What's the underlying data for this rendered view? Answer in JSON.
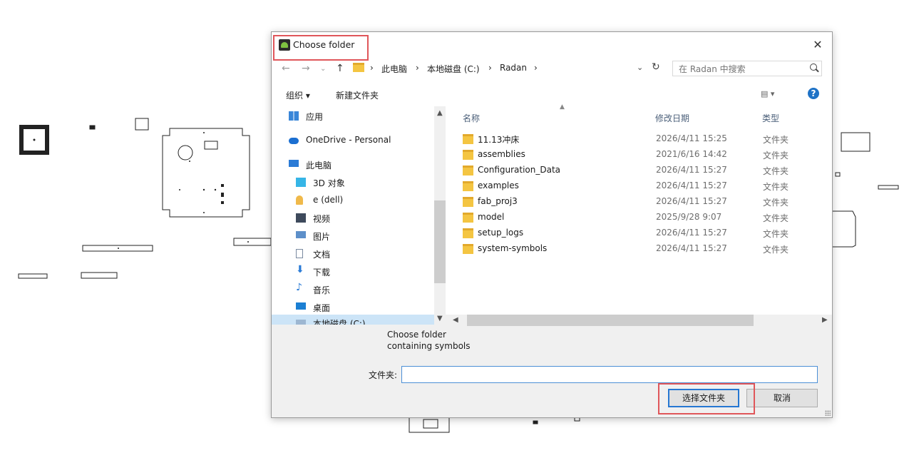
{
  "dialog": {
    "title": "Choose folder",
    "close_icon": "close-icon",
    "address": {
      "crumbs": [
        "此电脑",
        "本地磁盘 (C:)",
        "Radan"
      ],
      "separator": "›"
    },
    "search": {
      "placeholder": "在 Radan 中搜索"
    },
    "commands": {
      "organize": "组织 ▾",
      "new_folder": "新建文件夹"
    },
    "nav_pane": {
      "items": [
        {
          "label": "应用",
          "icon": "apps-icon"
        },
        {
          "label": "OneDrive - Personal",
          "icon": "cloud-icon"
        },
        {
          "label": "此电脑",
          "icon": "computer-icon"
        },
        {
          "label": "3D 对象",
          "icon": "cube-icon"
        },
        {
          "label": "e (dell)",
          "icon": "user-icon"
        },
        {
          "label": "视频",
          "icon": "video-icon"
        },
        {
          "label": "图片",
          "icon": "picture-icon"
        },
        {
          "label": "文档",
          "icon": "document-icon"
        },
        {
          "label": "下载",
          "icon": "download-icon"
        },
        {
          "label": "音乐",
          "icon": "music-icon"
        },
        {
          "label": "桌面",
          "icon": "desktop-icon"
        },
        {
          "label": "本地磁盘 (C:)",
          "icon": "drive-icon"
        }
      ],
      "selected": "本地磁盘 (C:)"
    },
    "columns": {
      "name": "名称",
      "date": "修改日期",
      "type": "类型"
    },
    "rows": [
      {
        "name": "11.13冲床",
        "date": "2026/4/11 15:25",
        "type": "文件夹"
      },
      {
        "name": "assemblies",
        "date": "2021/6/16 14:42",
        "type": "文件夹"
      },
      {
        "name": "Configuration_Data",
        "date": "2026/4/11 15:27",
        "type": "文件夹"
      },
      {
        "name": "examples",
        "date": "2026/4/11 15:27",
        "type": "文件夹"
      },
      {
        "name": "fab_proj3",
        "date": "2026/4/11 15:27",
        "type": "文件夹"
      },
      {
        "name": "model",
        "date": "2025/9/28 9:07",
        "type": "文件夹"
      },
      {
        "name": "setup_logs",
        "date": "2026/4/11 15:27",
        "type": "文件夹"
      },
      {
        "name": "system-symbols",
        "date": "2026/4/11 15:27",
        "type": "文件夹"
      }
    ],
    "description_lines": [
      "Choose folder",
      "containing symbols"
    ],
    "folder_label": "文件夹:",
    "folder_value": "",
    "buttons": {
      "select": "选择文件夹",
      "cancel": "取消"
    }
  }
}
